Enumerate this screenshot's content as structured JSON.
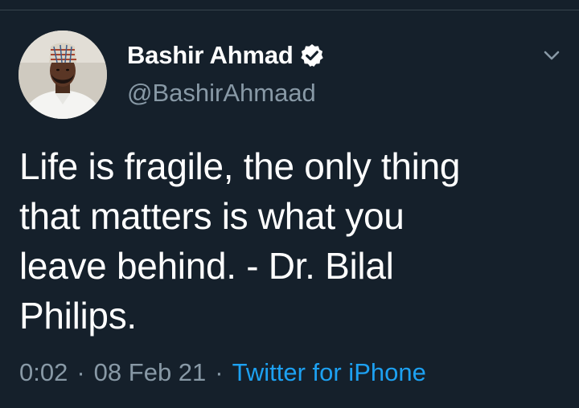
{
  "tweet": {
    "author": {
      "display_name": "Bashir Ahmad",
      "handle": "@BashirAhmaad",
      "verified": true,
      "avatar": "profile-photo"
    },
    "text": "Life is fragile, the only thing\nthat matters is what you\nleave behind. - Dr. Bilal\nPhilips.",
    "time": "0:02",
    "date": "08 Feb 21",
    "separator": "·",
    "source": "Twitter for iPhone",
    "menu_icon": "chevron-down-icon"
  },
  "colors": {
    "background": "#15202b",
    "primary_text": "#ffffff",
    "secondary_text": "#8899a6",
    "link": "#1da1f2",
    "divider": "#38444d"
  }
}
